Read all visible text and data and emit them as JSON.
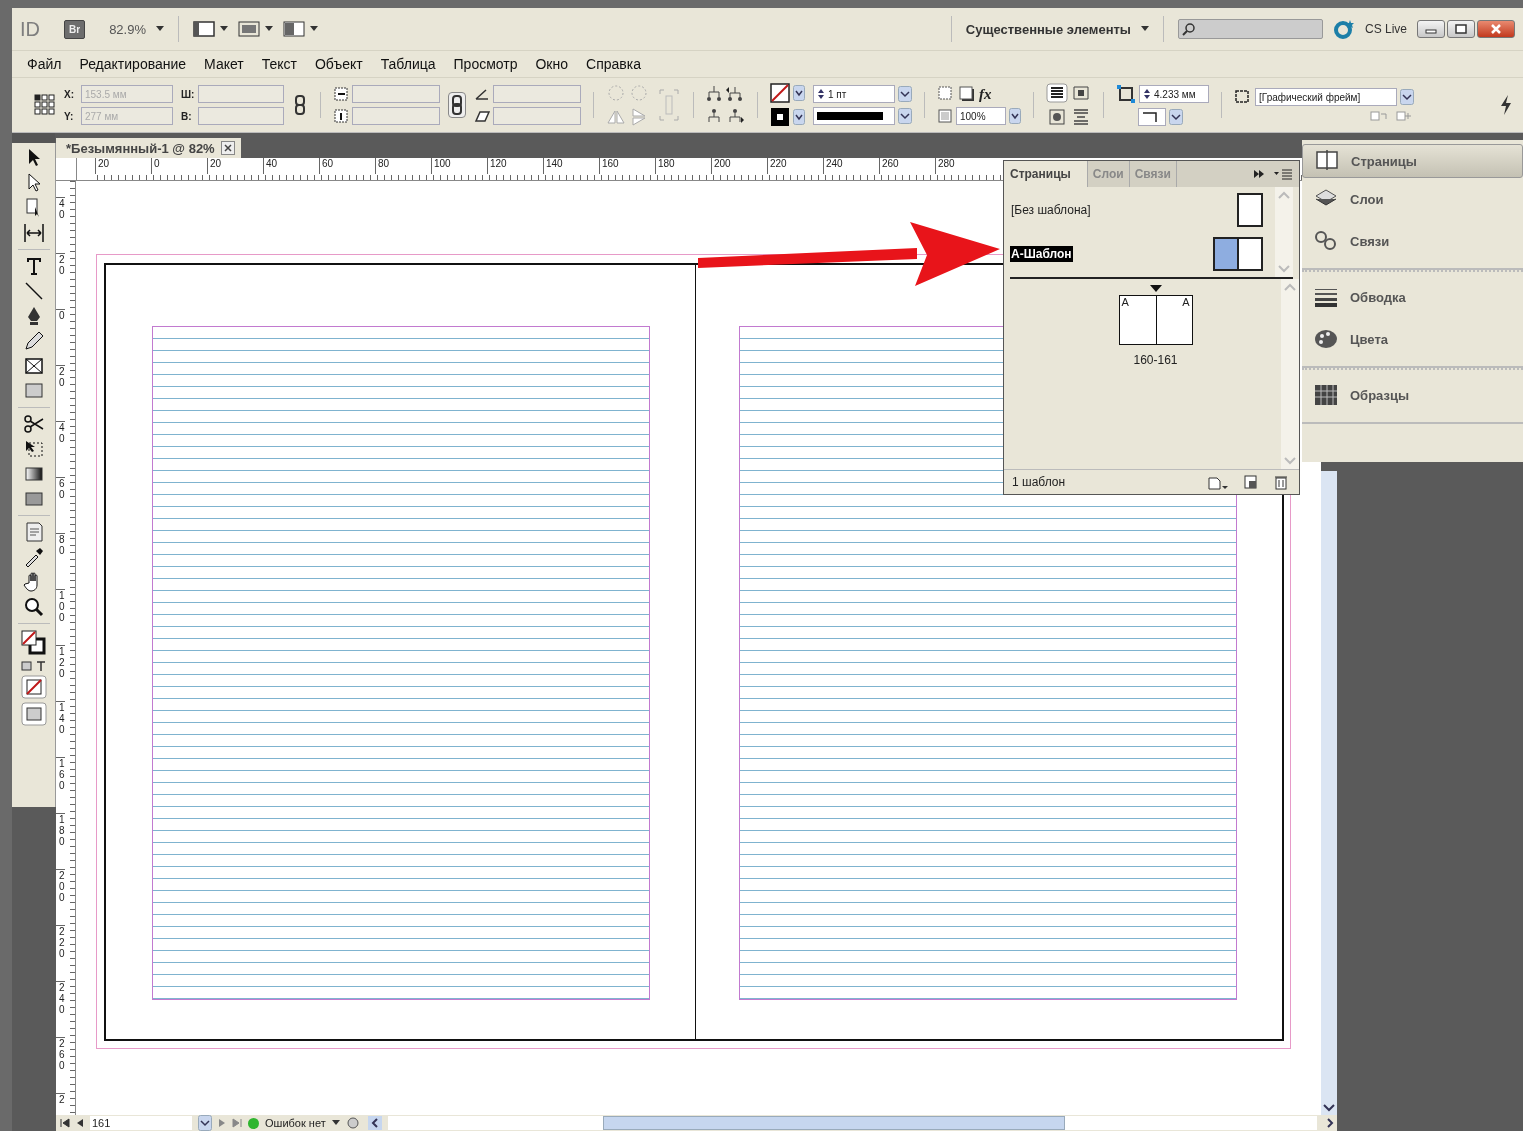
{
  "app_bar": {
    "logo": "ID",
    "bridge": "Br",
    "zoom": "82.9%",
    "workspace": "Существенные элементы",
    "cs_live": "CS Live"
  },
  "menu": [
    "Файл",
    "Редактирование",
    "Макет",
    "Текст",
    "Объект",
    "Таблица",
    "Просмотр",
    "Окно",
    "Справка"
  ],
  "control_panel": {
    "x_label": "X:",
    "x_value": "153.5 мм",
    "y_label": "Y:",
    "y_value": "277 мм",
    "w_label": "Ш:",
    "h_label": "В:",
    "disabled": true,
    "stroke_weight": "1 пт",
    "effects": "fx",
    "opacity": "100%",
    "corner_size": "4.233 мм",
    "object_style": "[Графический фрейм]"
  },
  "document_tab": {
    "title": "*Безымянный-1 @ 82%"
  },
  "ruler": {
    "horizontal": [
      "20",
      "0",
      "20",
      "40",
      "60",
      "80",
      "100",
      "120",
      "140",
      "160",
      "180",
      "200",
      "220",
      "240",
      "260",
      "280"
    ],
    "vertical": [
      "40",
      "20",
      "0",
      "20",
      "40",
      "60",
      "80",
      "100",
      "120",
      "140",
      "160",
      "180",
      "200",
      "220",
      "240",
      "260",
      "2"
    ]
  },
  "pages_panel": {
    "tabs": [
      {
        "label": "Страницы",
        "selected": true
      },
      {
        "label": "Слои",
        "selected": false
      },
      {
        "label": "Связи",
        "selected": false
      }
    ],
    "masters": [
      {
        "name": "[Без шаблона]",
        "selected": false,
        "kind": "single"
      },
      {
        "name": "А-Шаблон",
        "selected": true,
        "kind": "spread"
      }
    ],
    "spread": {
      "left_prefix": "A",
      "right_prefix": "A",
      "label": "160-161"
    },
    "footer": "1 шаблон"
  },
  "dock": [
    {
      "items": [
        {
          "label": "Страницы",
          "selected": true
        },
        {
          "label": "Слои",
          "selected": false
        },
        {
          "label": "Связи",
          "selected": false
        }
      ]
    },
    {
      "items": [
        {
          "label": "Обводка",
          "selected": false
        },
        {
          "label": "Цвета",
          "selected": false
        }
      ]
    },
    {
      "items": [
        {
          "label": "Образцы",
          "selected": false
        }
      ]
    }
  ],
  "status_bar": {
    "page": "161",
    "preflight": "Ошибок нет"
  }
}
